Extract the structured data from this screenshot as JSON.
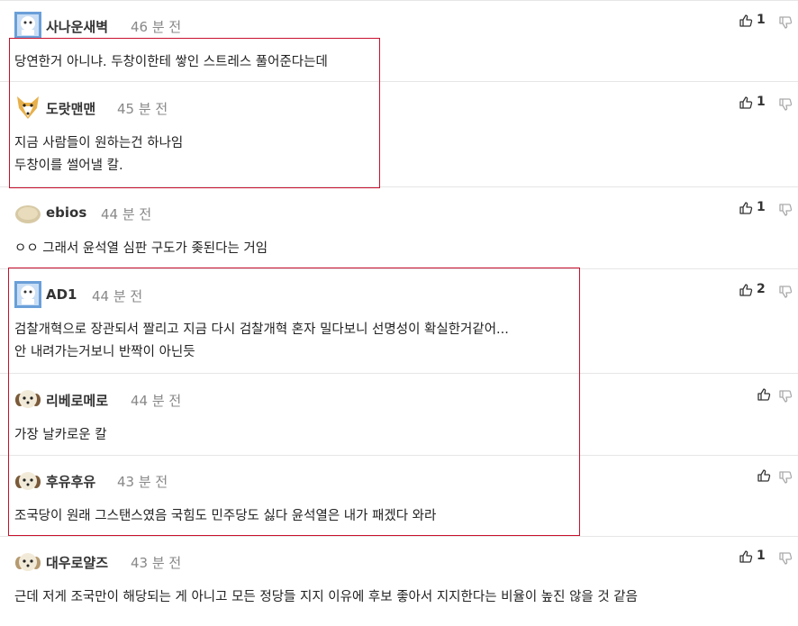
{
  "comments": [
    {
      "nick": "사나운새벽",
      "time": "46 분 전",
      "lines": [
        "당연한거 아니냐. 두창이한테 쌓인 스트레스 풀어준다는데"
      ],
      "votes": "1"
    },
    {
      "nick": "도랏맨맨",
      "time": "45 분 전",
      "lines": [
        "지금 사람들이 원하는건 하나임",
        "두창이를 썰어낼 칼."
      ],
      "votes": "1"
    },
    {
      "nick": "ebios",
      "time": "44 분 전",
      "lines": [
        "ㅇㅇ 그래서 윤석열 심판 구도가 좆된다는 거임"
      ],
      "votes": "1"
    },
    {
      "nick": "AD1",
      "time": "44 분 전",
      "lines": [
        "검찰개혁으로 장관되서 짤리고 지금 다시 검찰개혁 혼자 밀다보니 선명성이 확실한거같어...",
        "안 내려가는거보니 반짝이 아닌듯"
      ],
      "votes": "2"
    },
    {
      "nick": "리베로메로",
      "time": "44 분 전",
      "lines": [
        "가장 날카로운 칼"
      ],
      "votes": ""
    },
    {
      "nick": "후유후유",
      "time": "43 분 전",
      "lines": [
        "조국당이 원래 그스탠스였음 국힘도 민주당도 싫다 윤석열은 내가 패겠다 와라"
      ],
      "votes": ""
    },
    {
      "nick": "대우로얄즈",
      "time": "43 분 전",
      "lines": [
        "근데 저게 조국만이 해당되는 게 아니고 모든 정당들 지지 이유에 후보 좋아서 지지한다는 비율이 높진 않을 것 같음"
      ],
      "votes": "1"
    }
  ],
  "icons": {
    "like": "thumbs-up-icon",
    "dislike": "thumbs-down-icon"
  },
  "colors": {
    "highlight": "#c8102e",
    "time": "#888888",
    "border": "#e6e6e6"
  }
}
